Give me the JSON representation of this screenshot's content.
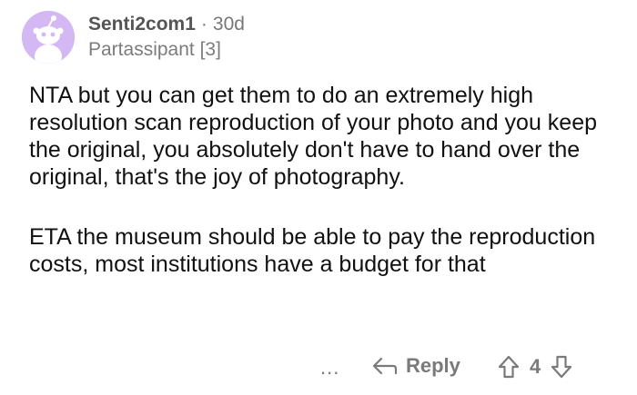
{
  "comment": {
    "username": "Senti2com1",
    "separator": "·",
    "age": "30d",
    "flair": "Partassipant [3]",
    "paragraphs": [
      "NTA but you can get them to do an extremely high resolution scan reproduction of your photo and you keep the original, you absolutely don't have to hand over the original, that's the joy of photography.",
      "ETA the museum should be able to pay the reproduction costs, most institutions have a budget for that"
    ],
    "avatar_color": "#d3b8f3"
  },
  "actions": {
    "more_label": "...",
    "reply_label": "Reply",
    "vote_count": "4",
    "icons": [
      "more-icon",
      "reply-arrow-icon",
      "upvote-icon",
      "downvote-icon"
    ]
  }
}
